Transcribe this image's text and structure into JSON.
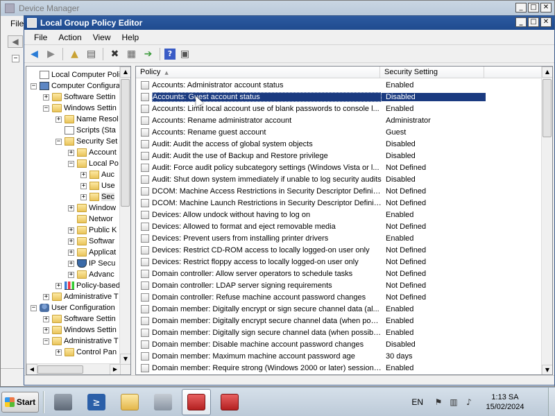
{
  "background_window": {
    "title": "Device Manager",
    "menu_stub": "File"
  },
  "window": {
    "title": "Local Group Policy Editor",
    "controls": [
      "_",
      "□",
      "✕"
    ]
  },
  "menubar": [
    "File",
    "Action",
    "View",
    "Help"
  ],
  "toolbar": {
    "icons": [
      "back-icon",
      "forward-icon",
      "up-folder-icon",
      "show-hide-tree-icon",
      "delete-icon",
      "properties-icon",
      "export-list-icon",
      "help-icon",
      "console-icon"
    ]
  },
  "tree": [
    {
      "label": "Local Computer Policy",
      "level": 0,
      "expander": "",
      "icon": "doc",
      "selected": false
    },
    {
      "label": "Computer Configura",
      "level": 0,
      "expander": "−",
      "icon": "computer"
    },
    {
      "label": "Software Settin",
      "level": 1,
      "expander": "+",
      "icon": "folder"
    },
    {
      "label": "Windows Settin",
      "level": 1,
      "expander": "−",
      "icon": "folder"
    },
    {
      "label": "Name Resol",
      "level": 2,
      "expander": "+",
      "icon": "folder"
    },
    {
      "label": "Scripts (Sta",
      "level": 2,
      "expander": "",
      "icon": "doc"
    },
    {
      "label": "Security Set",
      "level": 2,
      "expander": "−",
      "icon": "lockfolder"
    },
    {
      "label": "Account",
      "level": 3,
      "expander": "+",
      "icon": "lockfolder"
    },
    {
      "label": "Local Po",
      "level": 3,
      "expander": "−",
      "icon": "lockfolder"
    },
    {
      "label": "Auc",
      "level": 4,
      "expander": "+",
      "icon": "lockfolder"
    },
    {
      "label": "Use",
      "level": 4,
      "expander": "+",
      "icon": "lockfolder"
    },
    {
      "label": "Sec",
      "level": 4,
      "expander": "+",
      "icon": "lockfolder",
      "selected": true
    },
    {
      "label": "Window",
      "level": 3,
      "expander": "+",
      "icon": "folder"
    },
    {
      "label": "Networ",
      "level": 3,
      "expander": "",
      "icon": "folder"
    },
    {
      "label": "Public K",
      "level": 3,
      "expander": "+",
      "icon": "folder"
    },
    {
      "label": "Softwar",
      "level": 3,
      "expander": "+",
      "icon": "folder"
    },
    {
      "label": "Applicat",
      "level": 3,
      "expander": "+",
      "icon": "folder"
    },
    {
      "label": "IP Secu",
      "level": 3,
      "expander": "+",
      "icon": "shield"
    },
    {
      "label": "Advanc",
      "level": 3,
      "expander": "+",
      "icon": "folder"
    },
    {
      "label": "Policy-based",
      "level": 2,
      "expander": "+",
      "icon": "chart"
    },
    {
      "label": "Administrative T",
      "level": 1,
      "expander": "+",
      "icon": "folder"
    },
    {
      "label": "User Configuration",
      "level": 0,
      "expander": "−",
      "icon": "user"
    },
    {
      "label": "Software Settin",
      "level": 1,
      "expander": "+",
      "icon": "folder"
    },
    {
      "label": "Windows Settin",
      "level": 1,
      "expander": "+",
      "icon": "folder"
    },
    {
      "label": "Administrative T",
      "level": 1,
      "expander": "−",
      "icon": "folder"
    },
    {
      "label": "Control Pan",
      "level": 2,
      "expander": "+",
      "icon": "folder"
    }
  ],
  "list": {
    "columns": {
      "policy": "Policy",
      "setting": "Security Setting"
    },
    "rows": [
      {
        "policy": "Accounts: Administrator account status",
        "setting": "Enabled"
      },
      {
        "policy": "Accounts: Guest account status",
        "setting": "Disabled",
        "selected": true
      },
      {
        "policy": "Accounts: Limit local account use of blank passwords to console l...",
        "setting": "Enabled"
      },
      {
        "policy": "Accounts: Rename administrator account",
        "setting": "Administrator"
      },
      {
        "policy": "Accounts: Rename guest account",
        "setting": "Guest"
      },
      {
        "policy": "Audit: Audit the access of global system objects",
        "setting": "Disabled"
      },
      {
        "policy": "Audit: Audit the use of Backup and Restore privilege",
        "setting": "Disabled"
      },
      {
        "policy": "Audit: Force audit policy subcategory settings (Windows Vista or l...",
        "setting": "Not Defined"
      },
      {
        "policy": "Audit: Shut down system immediately if unable to log security audits",
        "setting": "Disabled"
      },
      {
        "policy": "DCOM: Machine Access Restrictions in Security Descriptor Definiti...",
        "setting": "Not Defined"
      },
      {
        "policy": "DCOM: Machine Launch Restrictions in Security Descriptor Definiti...",
        "setting": "Not Defined"
      },
      {
        "policy": "Devices: Allow undock without having to log on",
        "setting": "Enabled"
      },
      {
        "policy": "Devices: Allowed to format and eject removable media",
        "setting": "Not Defined"
      },
      {
        "policy": "Devices: Prevent users from installing printer drivers",
        "setting": "Enabled"
      },
      {
        "policy": "Devices: Restrict CD-ROM access to locally logged-on user only",
        "setting": "Not Defined"
      },
      {
        "policy": "Devices: Restrict floppy access to locally logged-on user only",
        "setting": "Not Defined"
      },
      {
        "policy": "Domain controller: Allow server operators to schedule tasks",
        "setting": "Not Defined"
      },
      {
        "policy": "Domain controller: LDAP server signing requirements",
        "setting": "Not Defined"
      },
      {
        "policy": "Domain controller: Refuse machine account password changes",
        "setting": "Not Defined"
      },
      {
        "policy": "Domain member: Digitally encrypt or sign secure channel data (al...",
        "setting": "Enabled"
      },
      {
        "policy": "Domain member: Digitally encrypt secure channel data (when poss...",
        "setting": "Enabled"
      },
      {
        "policy": "Domain member: Digitally sign secure channel data (when possible)",
        "setting": "Enabled"
      },
      {
        "policy": "Domain member: Disable machine account password changes",
        "setting": "Disabled"
      },
      {
        "policy": "Domain member: Maximum machine account password age",
        "setting": "30 days"
      },
      {
        "policy": "Domain member: Require strong (Windows 2000 or later) session ...",
        "setting": "Enabled"
      }
    ]
  },
  "taskbar": {
    "start_label": "Start",
    "apps": [
      {
        "name": "server-manager-icon",
        "style": "ic-servermgr",
        "active": false
      },
      {
        "name": "powershell-icon",
        "style": "ic-powershell",
        "glyph": "≥",
        "active": false
      },
      {
        "name": "explorer-icon",
        "style": "ic-explorer",
        "active": false
      },
      {
        "name": "admin-tools-icon",
        "style": "ic-tools",
        "active": false
      },
      {
        "name": "toolbox-icon",
        "style": "ic-toolbox",
        "active": true
      },
      {
        "name": "toolbox-icon",
        "style": "ic-toolbox",
        "active": false
      }
    ],
    "language": "EN",
    "time": "1:13 SA",
    "date": "15/02/2024"
  },
  "colors": {
    "title_active": "#1f4b8f",
    "selection": "#1a3a80"
  }
}
